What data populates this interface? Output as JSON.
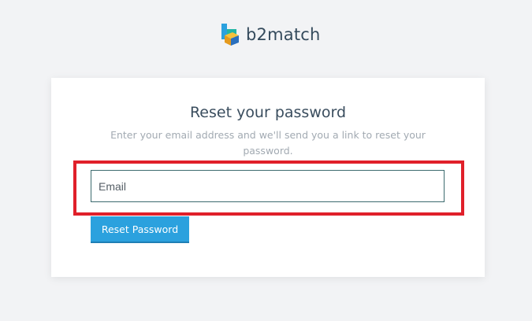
{
  "brand": {
    "name": "b2match",
    "logo_icon": "b2match-cube-logo-icon"
  },
  "form": {
    "title": "Reset your password",
    "subtitle": "Enter your email address and we'll send you a link to reset your password.",
    "email": {
      "placeholder": "Email",
      "value": ""
    },
    "submit_label": "Reset Password"
  },
  "colors": {
    "background": "#f2f3f5",
    "card": "#ffffff",
    "button": "#2ba1de",
    "highlight": "#e0202a",
    "title": "#3a4d5e"
  }
}
